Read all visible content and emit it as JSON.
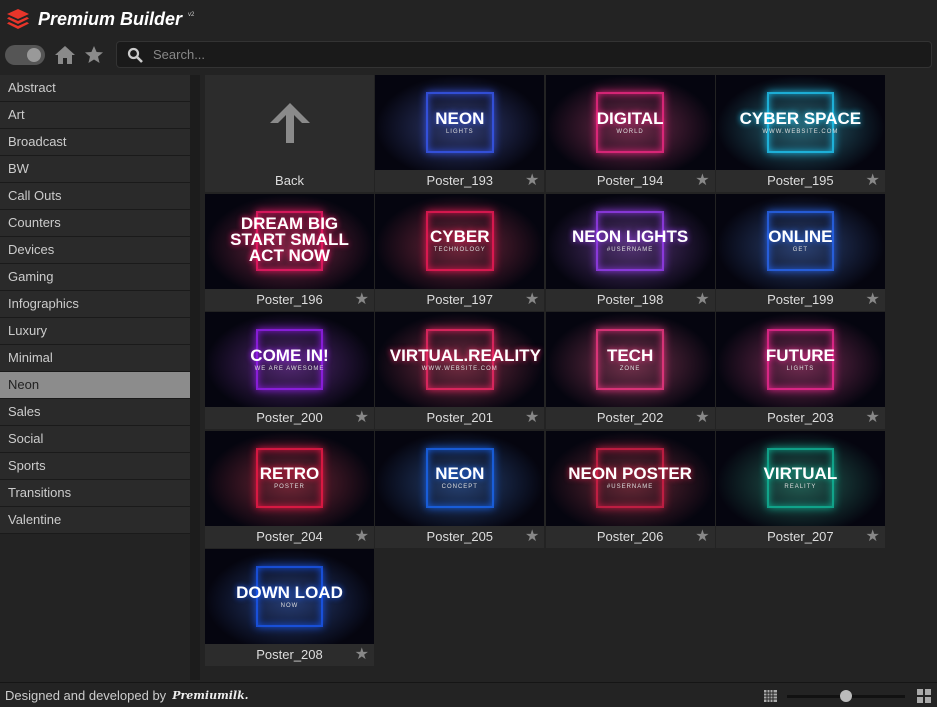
{
  "app": {
    "title": "Premium Builder",
    "version": "v2"
  },
  "search": {
    "placeholder": "Search..."
  },
  "categories": [
    "Abstract",
    "Art",
    "Broadcast",
    "BW",
    "Call Outs",
    "Counters",
    "Devices",
    "Gaming",
    "Infographics",
    "Luxury",
    "Minimal",
    "Neon",
    "Sales",
    "Social",
    "Sports",
    "Transitions",
    "Valentine"
  ],
  "selected_category": "Neon",
  "back_label": "Back",
  "items": [
    {
      "name": "Poster_193",
      "text": "NEON",
      "sub": "LIGHTS",
      "color": "#3a5cff"
    },
    {
      "name": "Poster_194",
      "text": "DIGITAL",
      "sub": "WORLD",
      "color": "#ff2a8a"
    },
    {
      "name": "Poster_195",
      "text": "CYBER SPACE",
      "sub": "WWW.WEBSITE.COM",
      "color": "#20d0ff"
    },
    {
      "name": "Poster_196",
      "text": "DREAM BIG START SMALL ACT NOW",
      "sub": "",
      "color": "#ff1a6a"
    },
    {
      "name": "Poster_197",
      "text": "CYBER",
      "sub": "TECHNOLOGY",
      "color": "#ff1a5a"
    },
    {
      "name": "Poster_198",
      "text": "NEON LIGHTS",
      "sub": "#USERNAME",
      "color": "#a040ff"
    },
    {
      "name": "Poster_199",
      "text": "ONLINE",
      "sub": "GET",
      "color": "#2a6cff"
    },
    {
      "name": "Poster_200",
      "text": "COME IN!",
      "sub": "WE ARE AWESOME",
      "color": "#a020ff"
    },
    {
      "name": "Poster_201",
      "text": "VIRTUAL.REALITY",
      "sub": "WWW.WEBSITE.COM",
      "color": "#ff2a6a"
    },
    {
      "name": "Poster_202",
      "text": "TECH",
      "sub": "ZONE",
      "color": "#ff3a8a"
    },
    {
      "name": "Poster_203",
      "text": "FUTURE",
      "sub": "LIGHTS",
      "color": "#ff2a9a"
    },
    {
      "name": "Poster_204",
      "text": "RETRO",
      "sub": "POSTER",
      "color": "#ff1a4a"
    },
    {
      "name": "Poster_205",
      "text": "NEON",
      "sub": "CONCEPT",
      "color": "#1a6cff"
    },
    {
      "name": "Poster_206",
      "text": "NEON POSTER",
      "sub": "#USERNAME",
      "color": "#e0204a"
    },
    {
      "name": "Poster_207",
      "text": "VIRTUAL",
      "sub": "REALITY",
      "color": "#10c0a0"
    },
    {
      "name": "Poster_208",
      "text": "DOWN LOAD",
      "sub": "NOW",
      "color": "#1a5cff"
    }
  ],
  "footer": {
    "credit": "Designed and developed by",
    "brand": "Premiumilk."
  },
  "thumb_size": 0.5,
  "accent": "#e8352a"
}
